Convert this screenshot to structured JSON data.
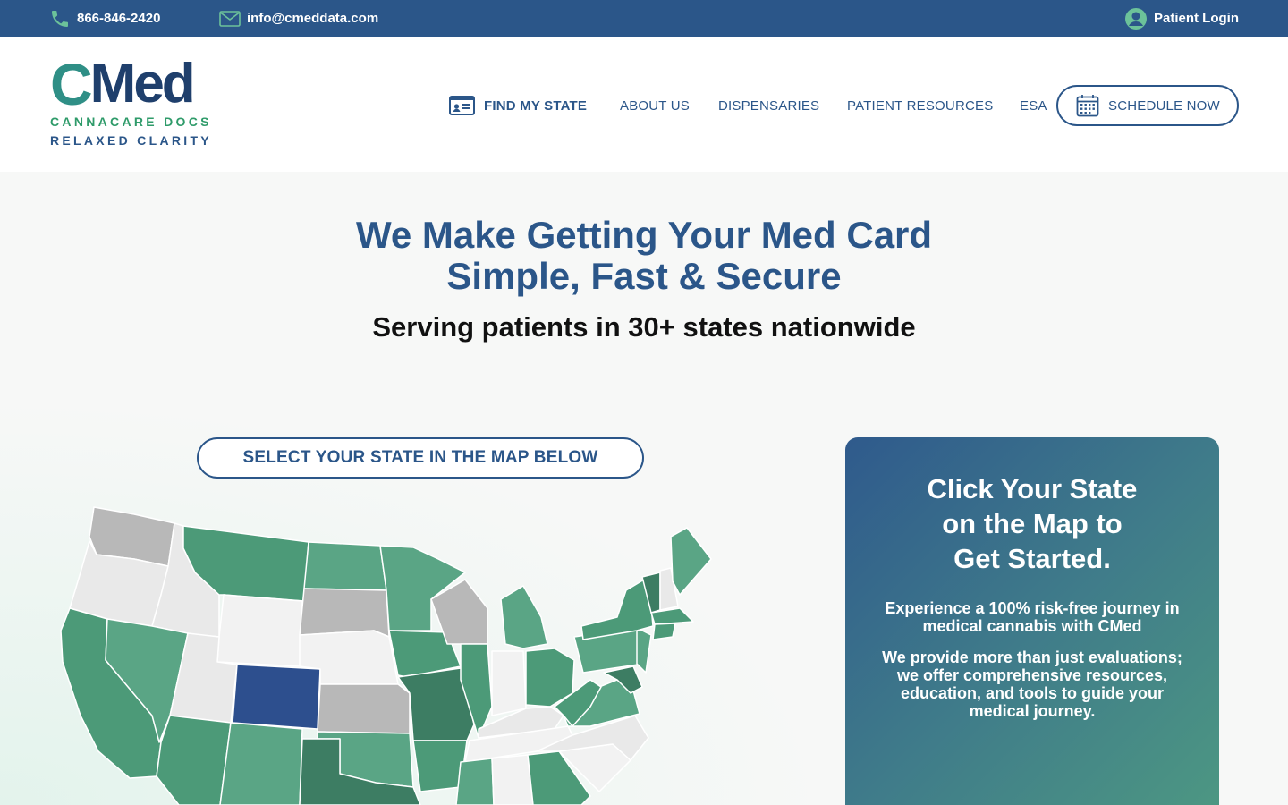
{
  "topbar": {
    "phone": "866-846-2420",
    "email": "info@cmeddata.com",
    "login": "Patient Login"
  },
  "logo": {
    "wordmark_c": "C",
    "wordmark_rest": "Med",
    "tagline1": "CANNACARE DOCS",
    "tagline2": "RELAXED CLARITY"
  },
  "nav": {
    "find_state": "FIND MY STATE",
    "about": "ABOUT US",
    "dispensaries": "DISPENSARIES",
    "resources": "PATIENT RESOURCES",
    "esa": "ESA",
    "schedule": "SCHEDULE NOW"
  },
  "hero": {
    "headline_line1": "We Make Getting Your Med Card",
    "headline_line2": "Simple, Fast & Secure",
    "subhead": "Serving patients in 30+ states nationwide",
    "select_button": "SELECT YOUR STATE IN THE MAP BELOW"
  },
  "card": {
    "title": "Click Your State on the Map to Get Started.",
    "p1": "Experience a 100% risk-free journey in medical cannabis with CMed",
    "p2": "We provide more than just evaluations; we offer comprehensive resources, education, and tools to guide your medical journey."
  },
  "colors": {
    "brand_blue": "#2b5689",
    "state_active": "#4c9a78",
    "state_dark": "#3d7d63",
    "state_inactive_gray": "#b8b8b8",
    "state_light": "#e9e9e9",
    "state_selected": "#2d4f8e"
  }
}
